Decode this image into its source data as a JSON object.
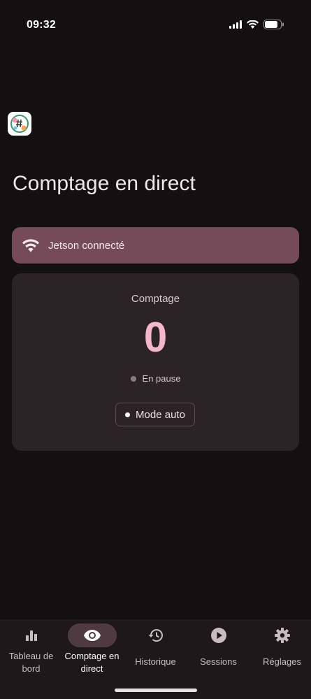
{
  "status_bar": {
    "time": "09:32"
  },
  "page": {
    "title": "Comptage en direct"
  },
  "connection": {
    "label": "Jetson connecté",
    "icon": "wifi-icon"
  },
  "counter": {
    "label": "Comptage",
    "value": "0",
    "state": "En pause",
    "mode_button": "Mode auto"
  },
  "nav": {
    "items": [
      {
        "label": "Tableau de bord",
        "icon": "bar-chart-icon",
        "active": false
      },
      {
        "label": "Comptage en direct",
        "icon": "eye-icon",
        "active": true
      },
      {
        "label": "Historique",
        "icon": "history-icon",
        "active": false
      },
      {
        "label": "Sessions",
        "icon": "play-icon",
        "active": false
      },
      {
        "label": "Réglages",
        "icon": "gear-icon",
        "active": false
      }
    ]
  },
  "colors": {
    "background": "#141012",
    "banner": "#754b5a",
    "card": "#2c2326",
    "counter_value": "#f5b8ca",
    "nav_active_pill": "#4f3a41"
  }
}
